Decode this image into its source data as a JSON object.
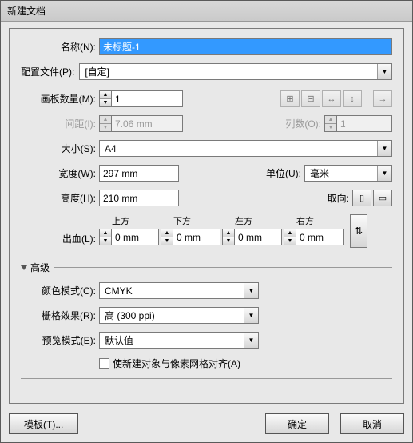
{
  "title": "新建文档",
  "name": {
    "label": "名称(N):",
    "value": "未标题-1"
  },
  "profile": {
    "label": "配置文件(P):",
    "value": "[自定]"
  },
  "artboards": {
    "label": "画板数量(M):",
    "value": "1"
  },
  "spacing": {
    "label": "间距(I):",
    "value": "7.06 mm"
  },
  "columns": {
    "label": "列数(O):",
    "value": "1"
  },
  "size": {
    "label": "大小(S):",
    "value": "A4"
  },
  "width": {
    "label": "宽度(W):",
    "value": "297 mm"
  },
  "height": {
    "label": "高度(H):",
    "value": "210 mm"
  },
  "units": {
    "label": "单位(U):",
    "value": "毫米"
  },
  "orientation": {
    "label": "取向:"
  },
  "bleed": {
    "label": "出血(L):",
    "top": {
      "label": "上方",
      "value": "0 mm"
    },
    "bottom": {
      "label": "下方",
      "value": "0 mm"
    },
    "left": {
      "label": "左方",
      "value": "0 mm"
    },
    "right": {
      "label": "右方",
      "value": "0 mm"
    }
  },
  "advanced": {
    "label": "高级"
  },
  "colorMode": {
    "label": "颜色模式(C):",
    "value": "CMYK"
  },
  "raster": {
    "label": "栅格效果(R):",
    "value": "高 (300 ppi)"
  },
  "preview": {
    "label": "预览模式(E):",
    "value": "默认值"
  },
  "align": {
    "label": "使新建对象与像素网格对齐(A)"
  },
  "buttons": {
    "template": "模板(T)...",
    "ok": "确定",
    "cancel": "取消"
  },
  "glyph": {
    "up": "▲",
    "down": "▼",
    "right": "→",
    "link": "⇅",
    "portrait": "▯",
    "landscape": "▭"
  }
}
